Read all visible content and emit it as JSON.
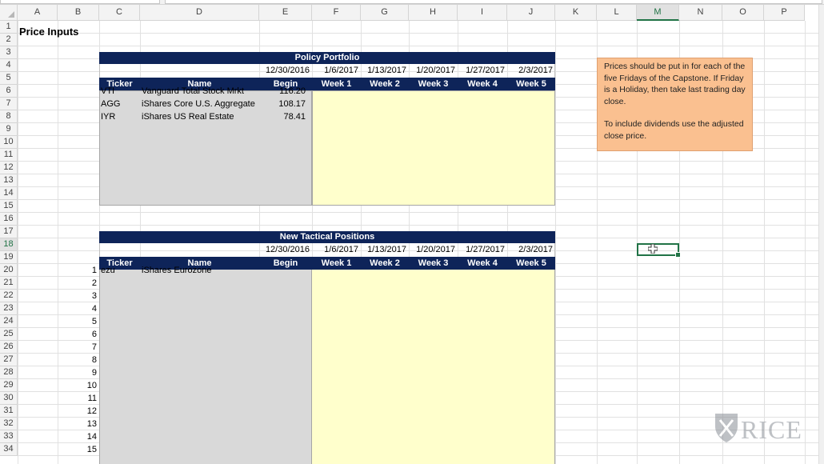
{
  "columns": [
    "A",
    "B",
    "C",
    "D",
    "E",
    "F",
    "G",
    "H",
    "I",
    "J",
    "K",
    "L",
    "M",
    "N",
    "O",
    "P"
  ],
  "selected_column": "M",
  "rows": [
    "1",
    "2",
    "3",
    "4",
    "5",
    "6",
    "7",
    "8",
    "9",
    "10",
    "11",
    "12",
    "13",
    "14",
    "15",
    "16",
    "17",
    "18",
    "19",
    "20",
    "21",
    "22",
    "23",
    "24",
    "25",
    "26",
    "27",
    "28",
    "29",
    "30",
    "31",
    "32",
    "33",
    "34"
  ],
  "selected_row": "18",
  "sheet_title": "Price Inputs",
  "policy": {
    "title": "Policy Portfolio",
    "dates": [
      "12/30/2016",
      "1/6/2017",
      "1/13/2017",
      "1/20/2017",
      "1/27/2017",
      "2/3/2017"
    ],
    "headers": [
      "Ticker",
      "Name",
      "Begin",
      "Week 1",
      "Week 2",
      "Week 3",
      "Week 4",
      "Week 5"
    ],
    "rows": [
      {
        "ticker": "VTI",
        "name": "Vanguard Total Stock Mrkt",
        "begin": "116.20"
      },
      {
        "ticker": "AGG",
        "name": "iShares Core U.S. Aggregate",
        "begin": "108.17"
      },
      {
        "ticker": "IYR",
        "name": "iShares US Real Estate",
        "begin": "78.41"
      }
    ]
  },
  "tactical": {
    "title": "New Tactical Positions",
    "dates": [
      "12/30/2016",
      "1/6/2017",
      "1/13/2017",
      "1/20/2017",
      "1/27/2017",
      "2/3/2017"
    ],
    "headers": [
      "Ticker",
      "Name",
      "Begin",
      "Week 1",
      "Week 2",
      "Week 3",
      "Week 4",
      "Week 5"
    ],
    "numbers": [
      "1",
      "2",
      "3",
      "4",
      "5",
      "6",
      "7",
      "8",
      "9",
      "10",
      "11",
      "12",
      "13",
      "14",
      "15"
    ],
    "rows": [
      {
        "ticker": "ezu",
        "name": "iShares Eurozone"
      }
    ]
  },
  "note": {
    "para1": "Prices should be put in for each  of the five Fridays of the Capstone. If Friday is a Holiday, then take last trading day close.",
    "para2": "To include dividends use the adjusted close price."
  },
  "logo": {
    "text": "RICE"
  },
  "colors": {
    "navy": "#0e2459",
    "grey": "#d9d9d9",
    "yellow": "#ffffcc",
    "note": "#fac090",
    "excel_green": "#217346"
  }
}
